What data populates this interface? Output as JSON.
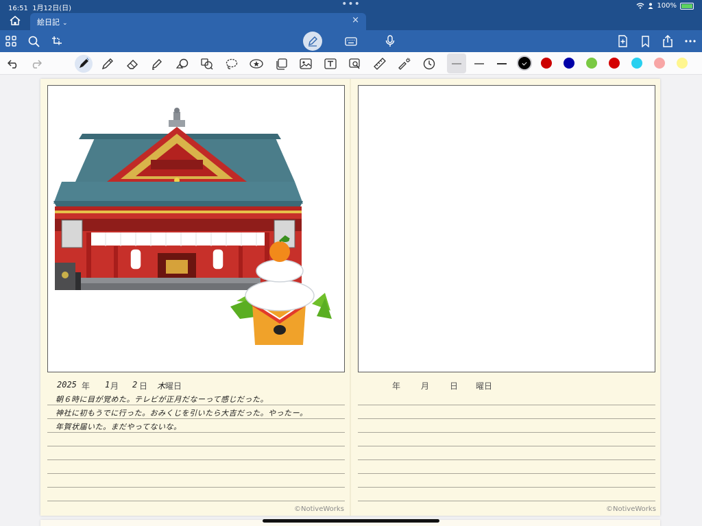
{
  "status": {
    "time": "16:51",
    "date": "1月12日(日)",
    "battery": "100%"
  },
  "tab": {
    "title": "絵日記"
  },
  "toolbar": {
    "thickness_options": [
      "thin",
      "medium",
      "thick"
    ],
    "selected_color": "#000000",
    "colors": [
      "#cc0000",
      "#0000a8",
      "#7ac943",
      "#d40000",
      "#29d0f0",
      "#f8a6a6",
      "#fff68f"
    ]
  },
  "left_page": {
    "date_labels": {
      "year": "年",
      "month": "月",
      "day": "日",
      "weekday": "曜日"
    },
    "date_values": {
      "year": "2025",
      "month": "1",
      "day": "2",
      "weekday": "木"
    },
    "notes": [
      "朝６時に目が覚めた。テレビが正月だなーって感じだった。",
      "神社に初もうでに行った。おみくじを引いたら大吉だった。やったー。",
      "年賀状届いた。まだやってないな。"
    ],
    "credit": "©NotiveWorks"
  },
  "right_page": {
    "date_labels": {
      "year": "年",
      "month": "月",
      "day": "日",
      "weekday": "曜日"
    },
    "credit": "©NotiveWorks"
  }
}
